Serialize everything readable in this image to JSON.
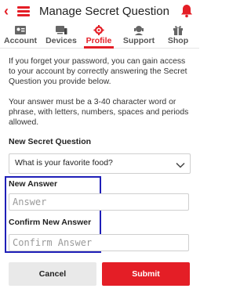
{
  "header": {
    "title": "Manage Secret Question"
  },
  "tabs": [
    {
      "label": "Account",
      "icon": "account-icon"
    },
    {
      "label": "Devices",
      "icon": "devices-icon"
    },
    {
      "label": "Profile",
      "icon": "profile-icon",
      "active": true
    },
    {
      "label": "Support",
      "icon": "support-icon"
    },
    {
      "label": "Shop",
      "icon": "gift-icon"
    }
  ],
  "info": {
    "paragraph1": "If you forget your password, you can gain access to your account by correctly answering the Secret Question you provide below.",
    "paragraph2": "Your answer must be a 3-40 character word or phrase, with letters, numbers, spaces and periods allowed."
  },
  "secret_question": {
    "label": "New Secret Question",
    "selected": "What is your favorite food?"
  },
  "new_answer": {
    "label": "New Answer",
    "placeholder": "Answer",
    "value": ""
  },
  "confirm_answer": {
    "label": "Confirm New Answer",
    "placeholder": "Confirm Answer",
    "value": ""
  },
  "buttons": {
    "cancel": "Cancel",
    "submit": "Submit"
  },
  "colors": {
    "accent": "#e41e26",
    "highlight": "#1f1fb8"
  }
}
